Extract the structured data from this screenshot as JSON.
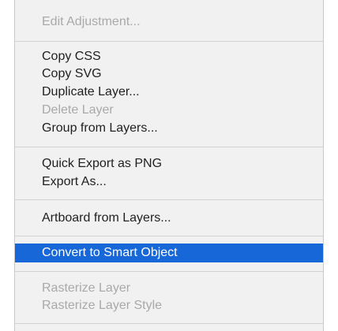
{
  "menu": {
    "edit_adjustment": "Edit Adjustment...",
    "copy_css": "Copy CSS",
    "copy_svg": "Copy SVG",
    "duplicate_layer": "Duplicate Layer...",
    "delete_layer": "Delete Layer",
    "group_from_layers": "Group from Layers...",
    "quick_export_png": "Quick Export as PNG",
    "export_as": "Export As...",
    "artboard_from_layers": "Artboard from Layers...",
    "convert_to_smart_object": "Convert to Smart Object",
    "rasterize_layer": "Rasterize Layer",
    "rasterize_layer_style": "Rasterize Layer Style"
  },
  "colors": {
    "highlight": "#1767d8",
    "menu_background": "#f1f1f1",
    "disabled_text": "#a9a9a9"
  }
}
